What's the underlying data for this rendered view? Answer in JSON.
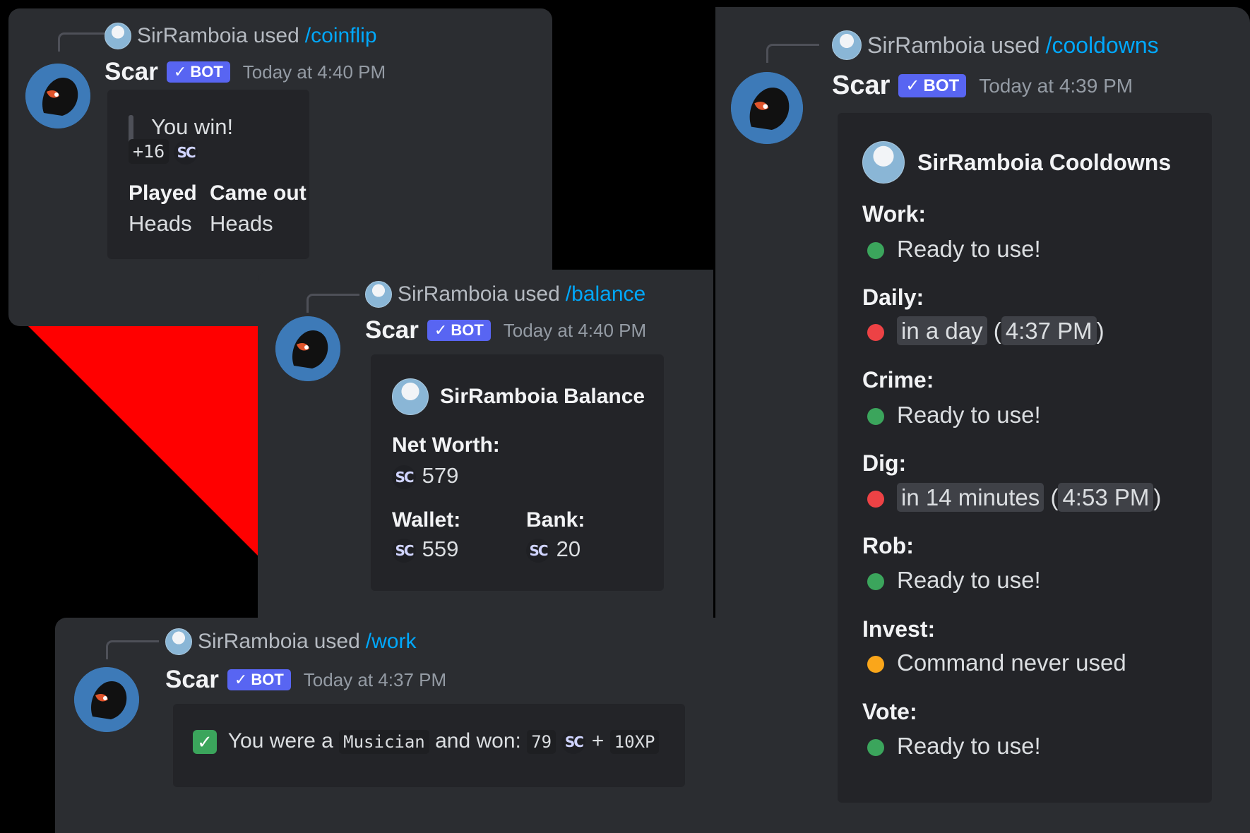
{
  "colors": {
    "background": "#000000",
    "panel": "#2b2d31",
    "embed": "#232428",
    "accent_red": "#ff0000",
    "bot_badge": "#5865f2",
    "command_link": "#00a8fc",
    "status_ready": "#3ba55c",
    "status_cooldown": "#ed4245",
    "status_never": "#faa61a"
  },
  "bot": {
    "name": "Scar",
    "badge": "BOT",
    "badge_icon": "checkmark-icon",
    "avatar_icon": "scar-lion-icon"
  },
  "coinflip": {
    "user": "SirRamboia",
    "used": "used",
    "command": "/coinflip",
    "time": "Today at 4:40 PM",
    "result": "You win!",
    "amount": "+16",
    "currency": "SC",
    "fields": [
      {
        "name": "Played",
        "value": "Heads"
      },
      {
        "name": "Came out",
        "value": "Heads"
      }
    ]
  },
  "balance": {
    "user": "SirRamboia",
    "used": "used",
    "command": "/balance",
    "time": "Today at 4:40 PM",
    "title": "SirRamboia Balance",
    "net_worth_label": "Net Worth:",
    "net_worth": "579",
    "wallet_label": "Wallet:",
    "wallet": "559",
    "bank_label": "Bank:",
    "bank": "20",
    "currency": "SC"
  },
  "work": {
    "user": "SirRamboia",
    "used": "used",
    "command": "/work",
    "time": "Today at 4:37 PM",
    "prefix": "You were a",
    "job": "Musician",
    "middle": "and won:",
    "amount": "79",
    "currency": "SC",
    "plus": "+",
    "xp": "10XP"
  },
  "cooldowns": {
    "user": "SirRamboia",
    "used": "used",
    "command": "/cooldowns",
    "time": "Today at 4:39 PM",
    "title": "SirRamboia Cooldowns",
    "items": [
      {
        "label": "Work:",
        "status": "ready",
        "text": "Ready to use!"
      },
      {
        "label": "Daily:",
        "status": "cooldown",
        "text": "in a day",
        "paren_open": "(",
        "at": "4:37 PM",
        "paren_close": ")"
      },
      {
        "label": "Crime:",
        "status": "ready",
        "text": "Ready to use!"
      },
      {
        "label": "Dig:",
        "status": "cooldown",
        "text": "in 14 minutes",
        "paren_open": "(",
        "at": "4:53 PM",
        "paren_close": ")"
      },
      {
        "label": "Rob:",
        "status": "ready",
        "text": "Ready to use!"
      },
      {
        "label": "Invest:",
        "status": "never",
        "text": "Command never used"
      },
      {
        "label": "Vote:",
        "status": "ready",
        "text": "Ready to use!"
      }
    ]
  }
}
